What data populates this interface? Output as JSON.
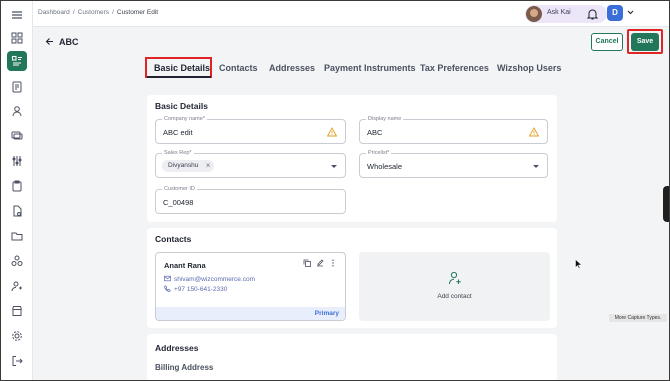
{
  "breadcrumb": [
    "Dashboard",
    "Customers",
    "Customer Edit"
  ],
  "topbar": {
    "ask_label": "Ask Kai",
    "user_initial": "D"
  },
  "page": {
    "title": "ABC",
    "cancel_label": "Cancel",
    "save_label": "Save"
  },
  "tabs": [
    "Basic Details",
    "Contacts",
    "Addresses",
    "Payment Instruments",
    "Tax Preferences",
    "Wizshop Users"
  ],
  "basic_details": {
    "title": "Basic Details",
    "company_name": {
      "label": "Company name*",
      "value": "ABC edit"
    },
    "display_name": {
      "label": "Display name",
      "value": "ABC"
    },
    "sales_rep": {
      "label": "Sales Rep*",
      "value": "Divyanshu"
    },
    "pricelist": {
      "label": "Pricelist*",
      "value": "Wholesale"
    },
    "customer_id": {
      "label": "Customer ID",
      "value": "C_00498"
    }
  },
  "contacts": {
    "title": "Contacts",
    "items": [
      {
        "name": "Anant Rana",
        "email": "shivam@wizcommerce.com",
        "phone": "+97 150-641-2330",
        "badge": "Primary"
      }
    ],
    "add_label": "Add contact"
  },
  "addresses": {
    "title": "Addresses",
    "billing_title": "Billing Address"
  },
  "tooltip": "More Capture Types.",
  "colors": {
    "accent": "#22775a",
    "highlight": "#e02424",
    "link": "#3b6fd8"
  }
}
